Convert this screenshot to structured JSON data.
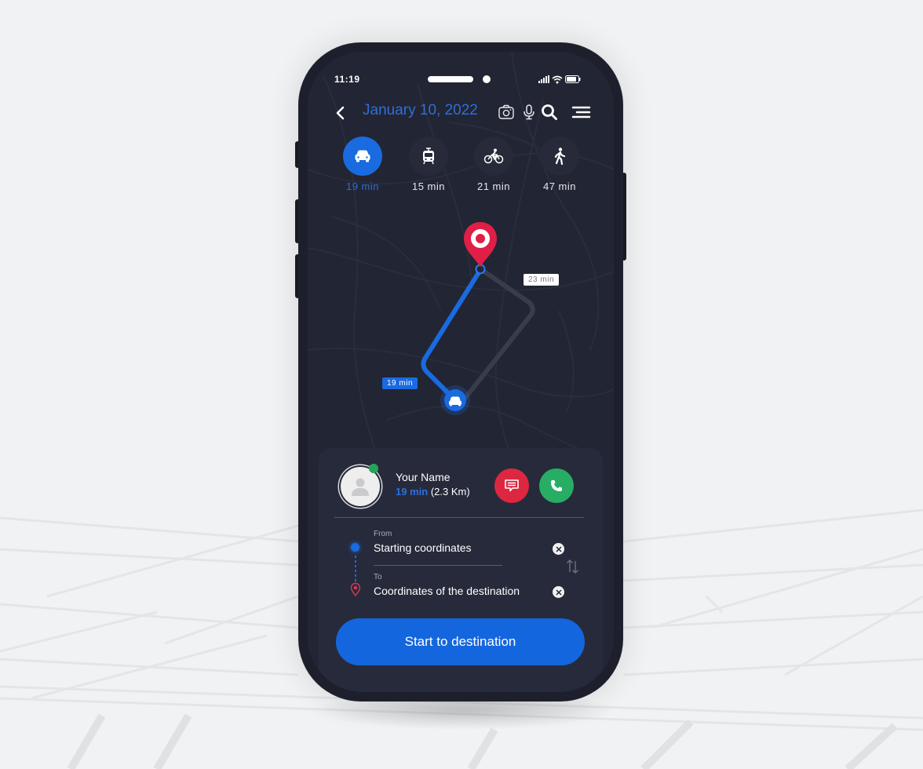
{
  "status_bar": {
    "time": "11:19",
    "icons": [
      "signal-icon",
      "wifi-icon",
      "battery-icon"
    ]
  },
  "header": {
    "back_icon": "chevron-left-icon",
    "title": "January 10, 2022",
    "actions": [
      {
        "name": "camera-icon"
      },
      {
        "name": "microphone-icon"
      },
      {
        "name": "search-icon"
      },
      {
        "name": "menu-icon"
      }
    ]
  },
  "modes": [
    {
      "id": "car",
      "icon": "car-icon",
      "label": "19 min",
      "active": true
    },
    {
      "id": "transit",
      "icon": "tram-icon",
      "label": "15 min",
      "active": false
    },
    {
      "id": "bike",
      "icon": "bicycle-icon",
      "label": "21 min",
      "active": false
    },
    {
      "id": "walk",
      "icon": "walk-icon",
      "label": "47 min",
      "active": false
    }
  ],
  "map": {
    "destination_icon": "location-pin-icon",
    "vehicle_icon": "car-icon",
    "routes": [
      {
        "type": "main",
        "label": "19 min",
        "color": "#1a6ae0"
      },
      {
        "type": "alternative",
        "label": "23 min",
        "color": "#3a3d4b"
      }
    ]
  },
  "driver": {
    "name": "Your Name",
    "eta": "19 min",
    "distance": "(2.3 Km)",
    "online": true,
    "message_icon": "chat-icon",
    "call_icon": "phone-icon"
  },
  "route_form": {
    "from_label": "From",
    "from_value": "Starting coordinates",
    "to_label": "To",
    "to_value": "Coordinates of the destination",
    "swap_icon": "swap-icon",
    "clear_icon": "close-icon"
  },
  "cta": {
    "label": "Start to destination"
  },
  "colors": {
    "accent": "#1a6ae0",
    "danger": "#dd2740",
    "success": "#27ae64",
    "background": "#222533"
  }
}
